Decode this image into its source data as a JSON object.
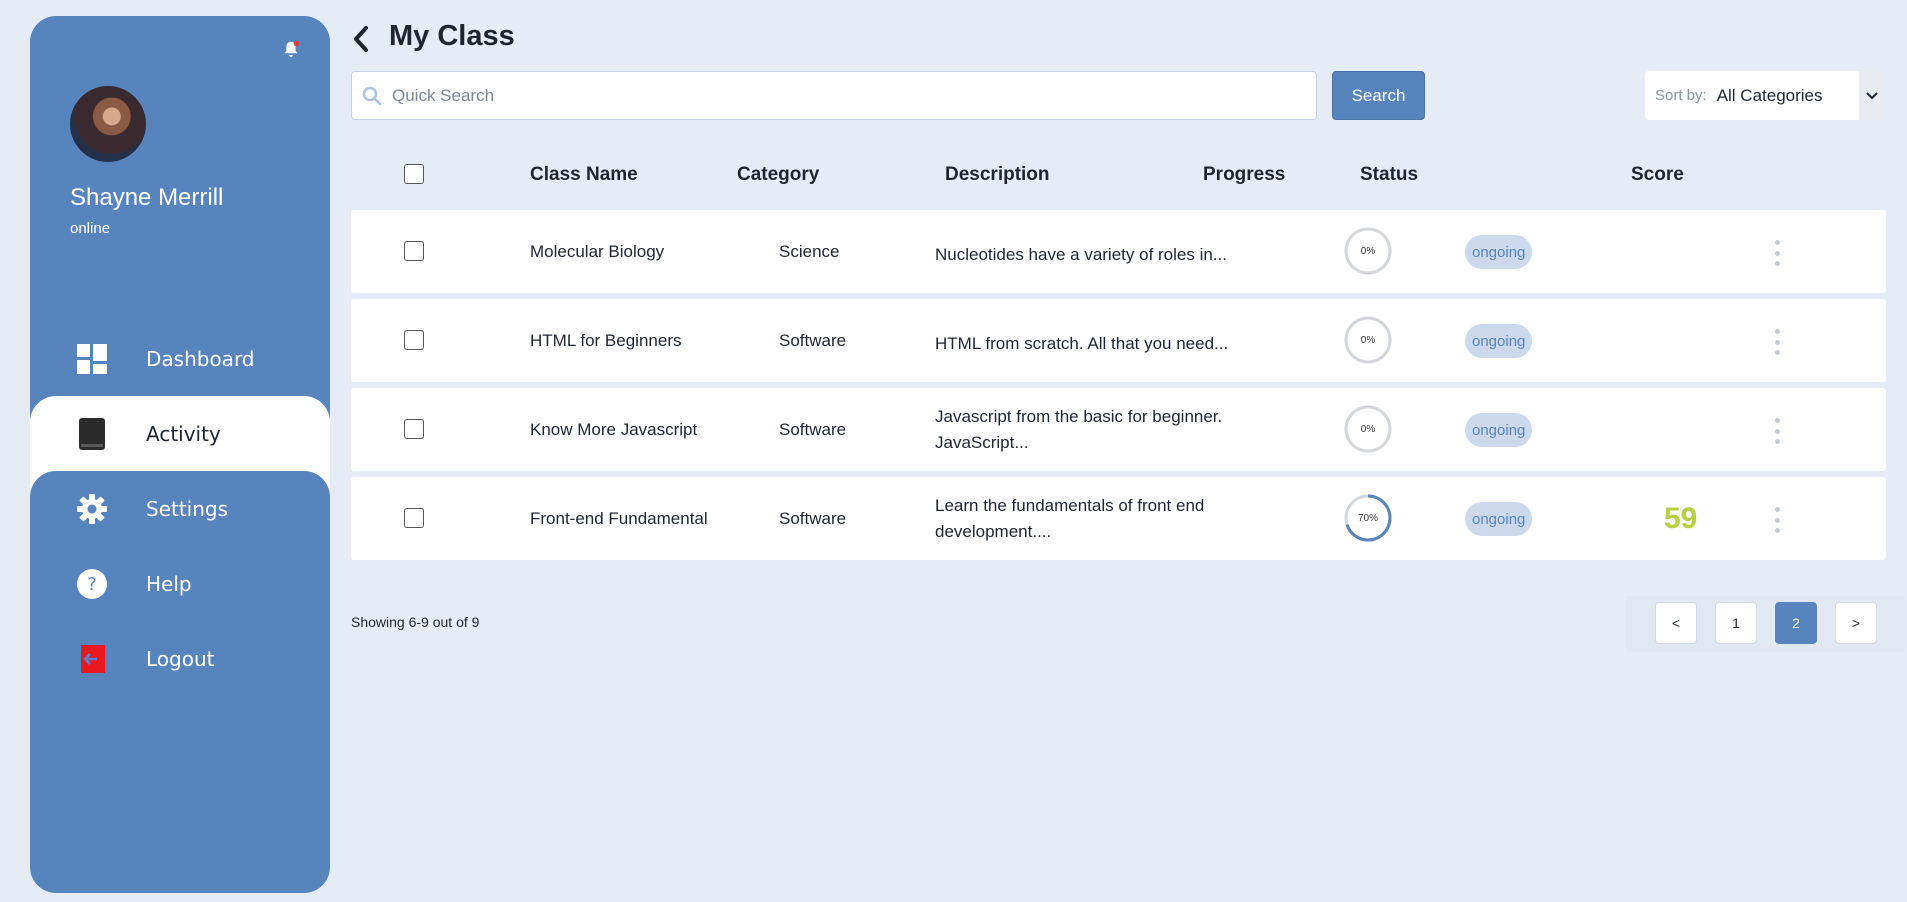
{
  "page": {
    "title": "My Class"
  },
  "user": {
    "name": "Shayne Merrill",
    "status": "online"
  },
  "nav": [
    {
      "label": "Dashboard",
      "icon": "dashboard-icon"
    },
    {
      "label": "Activity",
      "icon": "book-icon"
    },
    {
      "label": "Settings",
      "icon": "gear-icon"
    },
    {
      "label": "Help",
      "icon": "help-icon"
    },
    {
      "label": "Logout",
      "icon": "logout-icon"
    }
  ],
  "search": {
    "placeholder": "Quick Search",
    "button_label": "Search"
  },
  "sort": {
    "label": "Sort by:",
    "value": "All Categories"
  },
  "table": {
    "headers": {
      "name": "Class Name",
      "category": "Category",
      "description": "Description",
      "progress": "Progress",
      "status": "Status",
      "score": "Score"
    },
    "rows": [
      {
        "name": "Molecular Biology",
        "category": "Science",
        "description": "Nucleotides have a variety of roles in...",
        "progress_label": "0%",
        "progress": 0,
        "status": "ongoing",
        "score": ""
      },
      {
        "name": "HTML for Beginners",
        "category": "Software",
        "description": "HTML from scratch. All that you need...",
        "progress_label": "0%",
        "progress": 0,
        "status": "ongoing",
        "score": ""
      },
      {
        "name": "Know More Javascript",
        "category": "Software",
        "description": "Javascript from the basic for beginner. JavaScript...",
        "progress_label": "0%",
        "progress": 0,
        "status": "ongoing",
        "score": ""
      },
      {
        "name": "Front-end Fundamental",
        "category": "Software",
        "description": "Learn the fundamentals of front end development....",
        "progress_label": "70%",
        "progress": 0.7,
        "status": "ongoing",
        "score": "59"
      }
    ]
  },
  "pagination": {
    "showing": "Showing 6-9 out of 9",
    "prev": "<",
    "pages": [
      "1",
      "2"
    ],
    "current": "2",
    "next": ">"
  },
  "colors": {
    "accent": "#5784bc",
    "score": "#b8cf3e",
    "notification_dot": "#e53935",
    "background": "#e6ecf6"
  }
}
